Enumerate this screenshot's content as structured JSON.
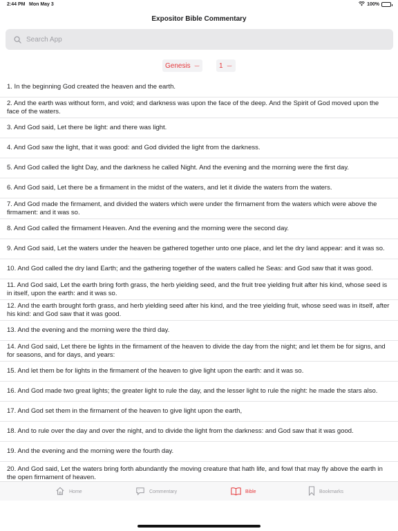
{
  "status_bar": {
    "time": "2:44 PM",
    "date": "Mon May 3",
    "battery": "100%"
  },
  "header": {
    "title": "Expositor Bible Commentary"
  },
  "search": {
    "placeholder": "Search App"
  },
  "selectors": {
    "book": "Genesis",
    "chapter": "1"
  },
  "verses": [
    "1. In the beginning God created the heaven and the earth.",
    "2. And the earth was without form, and void; and darkness was upon the face of the deep. And the Spirit of God moved upon the face of the waters.",
    "3. And God said, Let there be light: and there was light.",
    "4. And God saw the light, that it was good: and God divided the light from the darkness.",
    "5. And God called the light Day, and the darkness he called Night. And the evening and the morning were the first day.",
    "6. And God said, Let there be a firmament in the midst of the waters, and let it divide the waters from the waters.",
    "7. And God made the firmament, and divided the waters which were under the firmament from the waters which were above the firmament: and it was so.",
    "8. And God called the firmament Heaven. And the evening and the morning were the second day.",
    "9. And God said, Let the waters under the heaven be gathered together unto one place, and let the dry land appear: and it was so.",
    "10. And God called the dry land Earth; and the gathering together of the waters called he Seas: and God saw that it was good.",
    "11. And God said, Let the earth bring forth grass, the herb yielding seed, and the fruit tree yielding fruit after his kind, whose seed is in itself, upon the earth: and it was so.",
    "12. And the earth brought forth grass, and herb yielding seed after his kind, and the tree yielding fruit, whose seed was in itself, after his kind: and God saw that it was good.",
    "13. And the evening and the morning were the third day.",
    "14. And God said, Let there be lights in the firmament of the heaven to divide the day from the night; and let them be for signs, and for seasons, and for days, and years:",
    "15. And let them be for lights in the firmament of the heaven to give light upon the earth: and it was so.",
    "16. And God made two great lights; the greater light to rule the day, and the lesser light to rule the night: he made the stars also.",
    "17. And God set them in the firmament of the heaven to give light upon the earth,",
    "18. And to rule over the day and over the night, and to divide the light from the darkness: and God saw that it was good.",
    "19. And the evening and the morning were the fourth day.",
    "20. And God said, Let the waters bring forth abundantly the moving creature that hath life, and fowl that may fly above the earth in the open firmament of heaven."
  ],
  "tabs": [
    {
      "label": "Home",
      "icon": "house-icon",
      "active": false
    },
    {
      "label": "Commentary",
      "icon": "speech-bubble-icon",
      "active": false
    },
    {
      "label": "Bible",
      "icon": "open-book-icon",
      "active": true
    },
    {
      "label": "Bookmarks",
      "icon": "bookmark-icon",
      "active": false
    }
  ],
  "colors": {
    "accent": "#e5383b",
    "inactive_tab": "#9b9ba0",
    "list_background": "#f2f2f5"
  }
}
